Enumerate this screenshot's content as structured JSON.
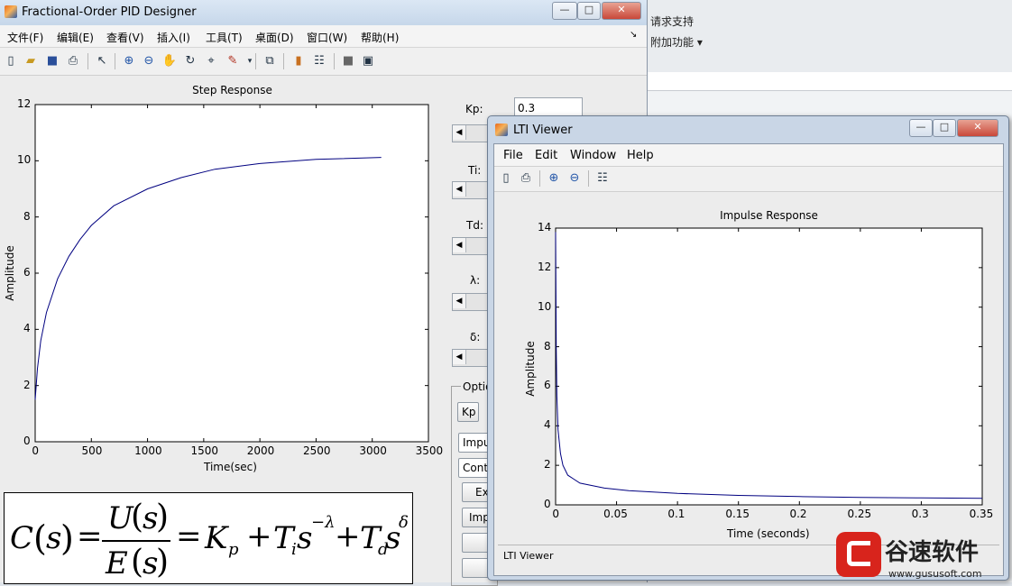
{
  "background_app": {
    "items": [
      "请求支持",
      "附加功能"
    ]
  },
  "main_window": {
    "title": "Fractional-Order PID Designer",
    "menu": [
      "文件(F)",
      "编辑(E)",
      "查看(V)",
      "插入(I)",
      "工具(T)",
      "桌面(D)",
      "窗口(W)",
      "帮助(H)"
    ],
    "toolbar_icons": [
      "new-figure-icon",
      "open-icon",
      "save-icon",
      "print-icon",
      "pointer-icon",
      "zoom-in-icon",
      "zoom-out-icon",
      "pan-icon",
      "rotate-icon",
      "data-cursor-icon",
      "brush-icon",
      "link-icon",
      "colorbar-icon",
      "legend-icon",
      "hide-plot-tools-icon",
      "show-plot-tools-icon"
    ],
    "params": {
      "kp_label": "Kp:",
      "kp_value": "0.3",
      "ti_label": "Ti:",
      "td_label": "Td:",
      "lambda_label": "λ:",
      "delta_label": "δ:"
    },
    "options": {
      "legend": "Optio",
      "kp_button": "Kp",
      "select1": "Impu",
      "select2": "Conti",
      "button1": "Ex",
      "button2": "Imp"
    },
    "formula": {
      "lhs": "C",
      "var": "s",
      "num": "U",
      "den": "E",
      "kp": "K",
      "kp_sub": "p",
      "ti": "T",
      "ti_sub": "i",
      "lambda_exp": "−λ",
      "td": "T",
      "td_sub": "d",
      "delta_exp": "δ"
    }
  },
  "step_chart": {
    "title": "Step Response",
    "xlabel": "Time(sec)",
    "ylabel": "Amplitude",
    "xticks": [
      "0",
      "500",
      "1000",
      "1500",
      "2000",
      "2500",
      "3000",
      "3500"
    ],
    "yticks": [
      "0",
      "2",
      "4",
      "6",
      "8",
      "10",
      "12"
    ]
  },
  "lti_window": {
    "title": "LTI Viewer",
    "menu": [
      "File",
      "Edit",
      "Window",
      "Help"
    ],
    "status": "LTI Viewer"
  },
  "impulse_chart": {
    "title": "Impulse Response",
    "xlabel": "Time (seconds)",
    "ylabel": "Amplitude",
    "xticks": [
      "0",
      "0.05",
      "0.1",
      "0.15",
      "0.2",
      "0.25",
      "0.3",
      "0.35"
    ],
    "yticks": [
      "0",
      "2",
      "4",
      "6",
      "8",
      "10",
      "12",
      "14"
    ]
  },
  "watermark": {
    "name": "谷速软件",
    "url": "www.gususoft.com"
  },
  "chart_data": [
    {
      "type": "line",
      "title": "Step Response",
      "xlabel": "Time(sec)",
      "ylabel": "Amplitude",
      "xlim": [
        0,
        3500
      ],
      "ylim": [
        0,
        12
      ],
      "grid": false,
      "series": [
        {
          "x": [
            0,
            20,
            50,
            100,
            200,
            300,
            400,
            500,
            700,
            1000,
            1300,
            1600,
            2000,
            2500,
            3080
          ],
          "y": [
            1.5,
            2.6,
            3.6,
            4.6,
            5.8,
            6.6,
            7.2,
            7.7,
            8.4,
            9.0,
            9.4,
            9.7,
            9.9,
            10.05,
            10.12
          ]
        }
      ],
      "color": "#000080"
    },
    {
      "type": "line",
      "title": "Impulse Response",
      "xlabel": "Time (seconds)",
      "ylabel": "Amplitude",
      "xlim": [
        0,
        0.35
      ],
      "ylim": [
        0,
        14
      ],
      "grid": false,
      "series": [
        {
          "x": [
            0,
            0.0005,
            0.001,
            0.002,
            0.004,
            0.006,
            0.01,
            0.02,
            0.04,
            0.06,
            0.1,
            0.15,
            0.2,
            0.25,
            0.3,
            0.35
          ],
          "y": [
            13.8,
            8.0,
            5.5,
            3.8,
            2.6,
            2.0,
            1.5,
            1.1,
            0.85,
            0.72,
            0.58,
            0.48,
            0.42,
            0.38,
            0.35,
            0.33
          ]
        }
      ],
      "color": "#000080"
    }
  ]
}
